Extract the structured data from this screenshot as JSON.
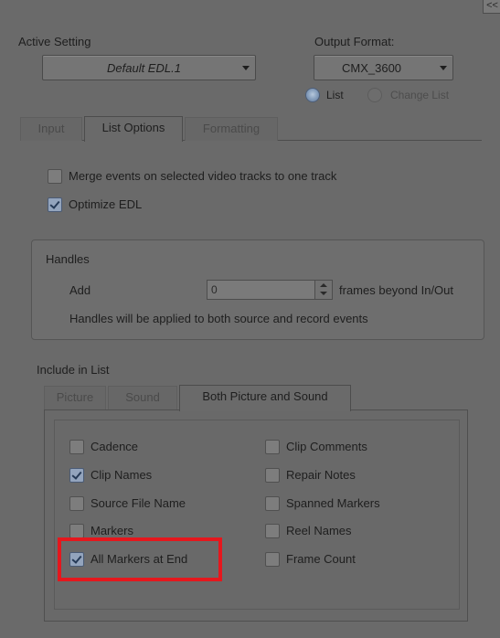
{
  "header": {
    "collapse_label": "<<",
    "active_setting_label": "Active Setting",
    "active_setting_value": "Default EDL.1",
    "output_format_label": "Output Format:",
    "output_format_value": "CMX_3600",
    "radio_list": "List",
    "radio_change_list": "Change List"
  },
  "tabs": [
    "Input",
    "List Options",
    "Formatting"
  ],
  "options": {
    "merge_events": "Merge events on selected video tracks to one track",
    "optimize_edl": "Optimize EDL"
  },
  "handles": {
    "title": "Handles",
    "add_label": "Add",
    "frames_value": "0",
    "frames_suffix": "frames beyond In/Out",
    "note": "Handles will be applied to both source and record events"
  },
  "include": {
    "title": "Include in List",
    "tabs": [
      "Picture",
      "Sound",
      "Both Picture and Sound"
    ],
    "left": [
      {
        "label": "Cadence",
        "checked": false
      },
      {
        "label": "Clip Names",
        "checked": true
      },
      {
        "label": "Source File Name",
        "checked": false
      },
      {
        "label": "Markers",
        "checked": false
      },
      {
        "label": "All Markers at End",
        "checked": true
      }
    ],
    "right": [
      {
        "label": "Clip Comments",
        "checked": false
      },
      {
        "label": "Repair Notes",
        "checked": false
      },
      {
        "label": "Spanned Markers",
        "checked": false
      },
      {
        "label": "Reel Names",
        "checked": false
      },
      {
        "label": "Frame Count",
        "checked": false
      }
    ]
  },
  "colors": {
    "background": "#6a6a6a",
    "highlight": "#e5171d",
    "radio_selected": "#8aa2bf"
  }
}
